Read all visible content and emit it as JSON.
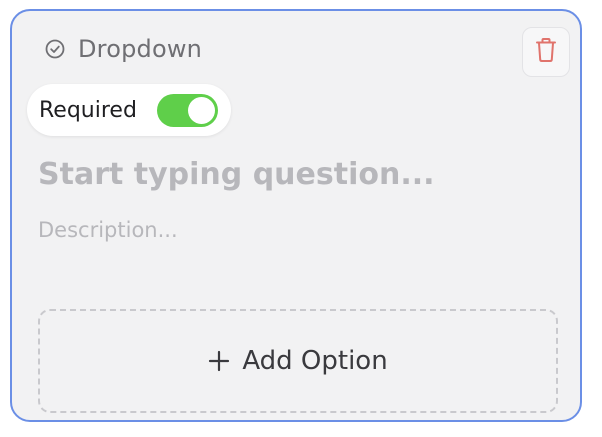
{
  "card": {
    "type_label": "Dropdown",
    "type_icon": "check-circle-icon",
    "delete_icon": "trash-icon",
    "required": {
      "label": "Required",
      "enabled": true
    },
    "question": {
      "value": "",
      "placeholder": "Start typing question..."
    },
    "description": {
      "value": "",
      "placeholder": "Description..."
    },
    "add_option": {
      "icon": "plus-icon",
      "label": "Add Option"
    }
  },
  "colors": {
    "accent_border": "#6b8fe6",
    "toggle_on": "#5fcf4a",
    "delete": "#e0736c"
  }
}
